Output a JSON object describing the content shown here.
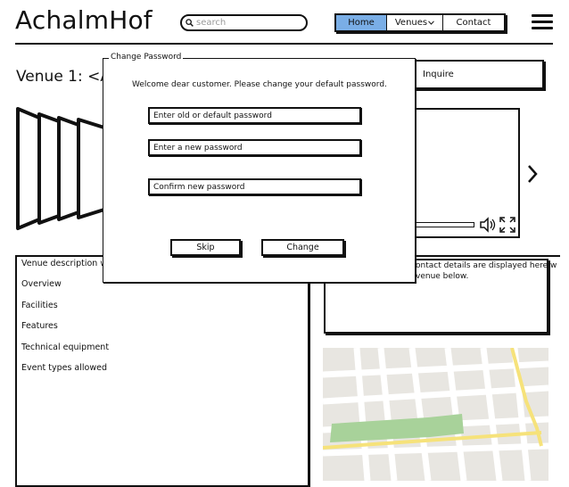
{
  "header": {
    "logo": "AchalmHof",
    "search_placeholder": "search",
    "nav": {
      "home": "Home",
      "venues": "Venues",
      "contact": "Contact"
    },
    "accent_color": "#7aaee6"
  },
  "venue": {
    "title": "Venue 1: <Ac",
    "inquire": "Inquire",
    "description_heading": "Venue description wi",
    "sections": [
      "Overview",
      "Facilities",
      "Features",
      "Technical equipment",
      "Event types allowed"
    ],
    "contact_text_line1": "ontact details are displayed here w",
    "contact_text_line2": "venue below."
  },
  "dialog": {
    "title": "Change Password",
    "welcome": "Welcome dear customer. Please change your default password.",
    "old_password": "Enter old or default password",
    "new_password": "Enter a new password",
    "confirm_password": "Confirm new password",
    "skip": "Skip",
    "change": "Change"
  }
}
